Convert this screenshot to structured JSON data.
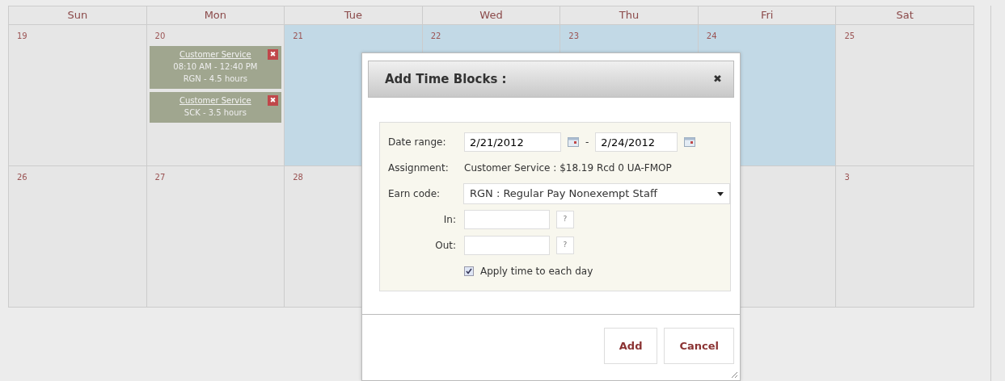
{
  "calendar": {
    "weekdays": [
      "Sun",
      "Mon",
      "Tue",
      "Wed",
      "Thu",
      "Fri",
      "Sat"
    ],
    "weeks": [
      {
        "days": [
          {
            "date": "19",
            "selected": false
          },
          {
            "date": "20",
            "selected": false,
            "blocks": [
              {
                "title": "Customer Service",
                "lines": [
                  "08:10 AM - 12:40 PM",
                  "RGN - 4.5 hours"
                ],
                "delete": "✖"
              },
              {
                "title": "Customer Service",
                "lines": [
                  "SCK - 3.5 hours"
                ],
                "delete": "✖"
              }
            ]
          },
          {
            "date": "21",
            "selected": true
          },
          {
            "date": "22",
            "selected": true
          },
          {
            "date": "23",
            "selected": true
          },
          {
            "date": "24",
            "selected": true
          },
          {
            "date": "25",
            "selected": false
          }
        ]
      },
      {
        "days": [
          {
            "date": "26",
            "selected": false
          },
          {
            "date": "27",
            "selected": false
          },
          {
            "date": "28",
            "selected": false
          }
        ],
        "saturday": {
          "date": "3",
          "selected": false
        }
      }
    ]
  },
  "dialog": {
    "title": "Add Time Blocks :",
    "close": "✖",
    "date_range": {
      "label": "Date range:",
      "from": "2/21/2012",
      "separator": "-",
      "to": "2/24/2012"
    },
    "assignment": {
      "label": "Assignment:",
      "value": "Customer Service : $18.19 Rcd 0 UA-FMOP"
    },
    "earn_code": {
      "label": "Earn code:",
      "value": "RGN : Regular Pay Nonexempt Staff"
    },
    "in": {
      "label": "In:",
      "help": "?"
    },
    "out": {
      "label": "Out:",
      "help": "?"
    },
    "apply_each_day": {
      "label": "Apply time to each day",
      "checked": true
    },
    "buttons": [
      "Add",
      "Cancel"
    ]
  }
}
